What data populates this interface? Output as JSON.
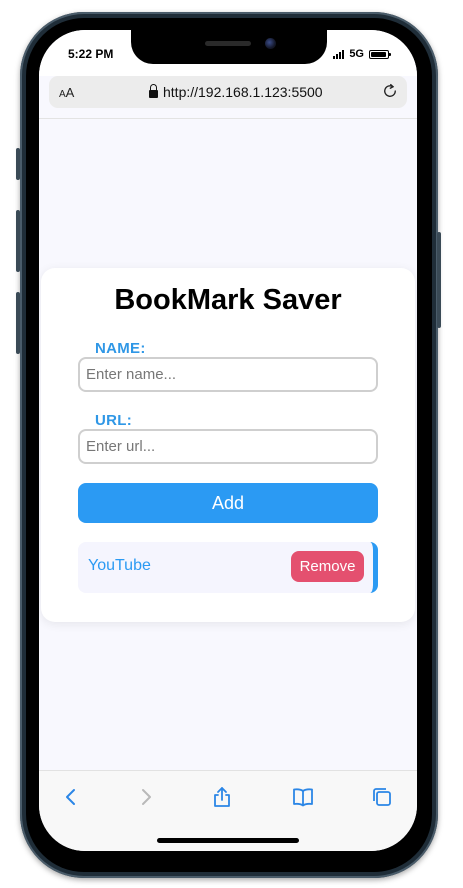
{
  "status": {
    "time": "5:22 PM",
    "network": "5G"
  },
  "browser": {
    "text_size_label_small": "A",
    "text_size_label_large": "A",
    "url": "http://192.168.1.123:5500",
    "toolbar_icons": [
      "back-icon",
      "forward-icon",
      "share-icon",
      "bookmarks-icon",
      "tabs-icon"
    ]
  },
  "app": {
    "title": "BookMark Saver",
    "name_label": "NAME:",
    "name_placeholder": "Enter name...",
    "url_label": "URL:",
    "url_placeholder": "Enter url...",
    "add_label": "Add",
    "bookmarks": [
      {
        "name": "YouTube",
        "remove_label": "Remove"
      }
    ]
  },
  "colors": {
    "accent": "#2b9af3",
    "remove": "#e4506f",
    "background": "#f8f8fe"
  }
}
